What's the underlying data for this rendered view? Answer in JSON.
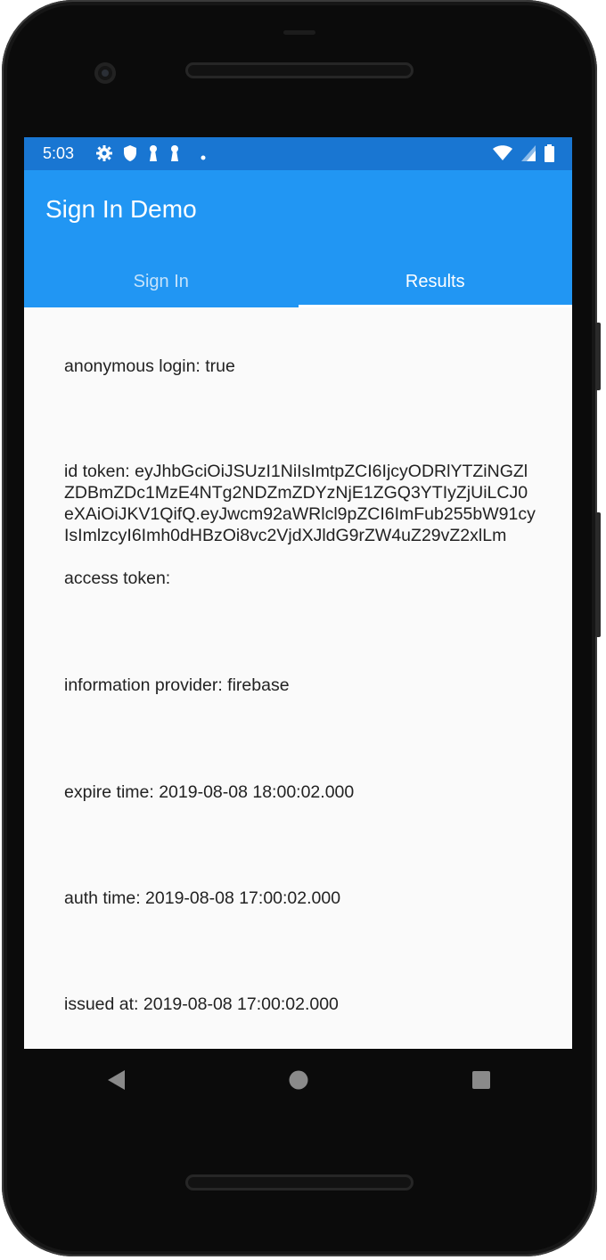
{
  "status_bar": {
    "time": "5:03",
    "left_icons": [
      "gear-icon",
      "shield-icon",
      "keyhole-icon",
      "keyhole-icon",
      "dot-icon"
    ],
    "right_icons": [
      "wifi-icon",
      "signal-icon",
      "battery-icon"
    ]
  },
  "app_bar": {
    "title": "Sign In Demo",
    "tabs": [
      {
        "label": "Sign In",
        "active": false
      },
      {
        "label": "Results",
        "active": true
      }
    ]
  },
  "results": {
    "anonymous_login": "anonymous login: true",
    "id_token": "id token: eyJhbGciOiJSUzI1NiIsImtpZCI6IjcyODRlYTZiNGZlZDBmZDc1MzE4NTg2NDZmZDYzNjE1ZGQ3YTIyZjUiLCJ0eXAiOiJKV1QifQ.eyJwcm92aWRlcl9pZCI6ImFub255bW91cyIsImlzcyI6Imh0dHBzOi8vc2VjdXJldG9rZW4uZ29vZ2xlLm",
    "access_token": "access token:",
    "provider": "information provider: firebase",
    "expire_time": "expire time: 2019-08-08 18:00:02.000",
    "auth_time": "auth time: 2019-08-08 17:00:02.000",
    "issued_at": "issued at: 2019-08-08 17:00:02.000"
  },
  "nav_bar": {
    "buttons": [
      "back-icon",
      "home-icon",
      "recents-icon"
    ]
  },
  "colors": {
    "status_bar": "#1976d2",
    "app_bar": "#2196f3",
    "background": "#fafafa"
  }
}
